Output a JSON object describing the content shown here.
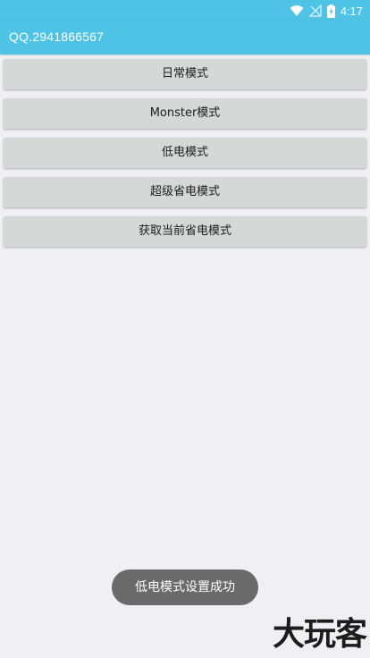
{
  "status_bar": {
    "time": "4:17",
    "icons": [
      "wifi-icon",
      "signal-off-icon",
      "battery-charging-icon"
    ]
  },
  "app_bar": {
    "title": "QQ.2941866567"
  },
  "buttons": [
    {
      "label": "日常模式"
    },
    {
      "label": "Monster模式"
    },
    {
      "label": "低电模式"
    },
    {
      "label": "超级省电模式"
    },
    {
      "label": "获取当前省电模式"
    }
  ],
  "toast": {
    "message": "低电模式设置成功"
  },
  "watermark": {
    "text": "大玩客"
  },
  "colors": {
    "primary": "#4fc3e6",
    "background": "#efeff4",
    "button": "#d6d7d7",
    "toast": "#6a6a6a"
  }
}
